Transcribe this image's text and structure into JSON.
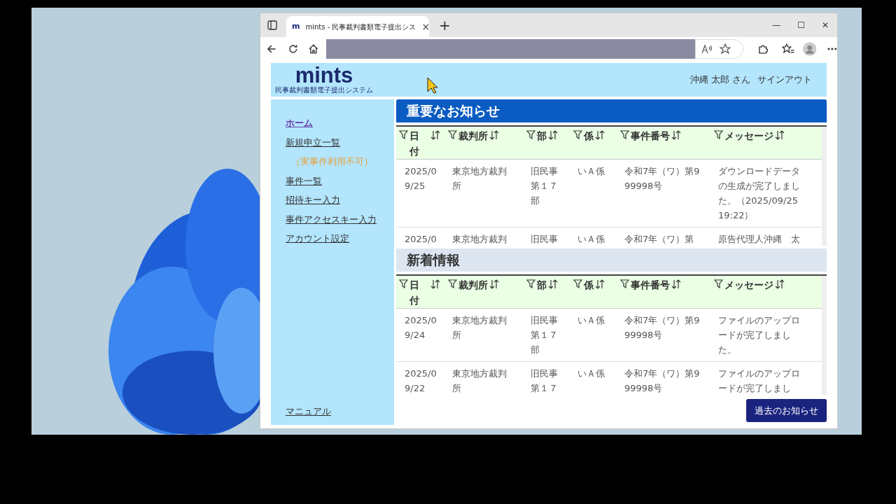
{
  "browser": {
    "favicon": "m",
    "tab_title": "mints - 民事裁判書類電子提出シス",
    "tab_close": "×",
    "new_tab": "+",
    "window_buttons": [
      "—",
      "☐",
      "✕"
    ]
  },
  "header": {
    "logo": "mints",
    "logo_subtitle": "民事裁判書類電子提出システム",
    "user": "沖縄 太郎 さん",
    "signout": "サインアウト"
  },
  "sidebar": {
    "items": [
      {
        "kind": "link",
        "label": "ホーム",
        "selected": true
      },
      {
        "kind": "link",
        "label": "新規申立一覧",
        "selected": false
      },
      {
        "kind": "note",
        "label": "（実事件利用不可）",
        "selected": false
      },
      {
        "kind": "link",
        "label": "事件一覧",
        "selected": false
      },
      {
        "kind": "link",
        "label": "招待キー入力",
        "selected": false
      },
      {
        "kind": "link",
        "label": "事件アクセスキー入力",
        "selected": false
      },
      {
        "kind": "link",
        "label": "アカウント設定",
        "selected": false
      }
    ],
    "footer_link": "マニュアル"
  },
  "sections": [
    {
      "title": "重要なお知らせ",
      "kind": "important",
      "columns": [
        "日付",
        "裁判所",
        "部",
        "係",
        "事件番号",
        "メッセージ"
      ],
      "rows": [
        [
          "2025/09/25",
          "東京地方裁判所",
          "旧民事第１７部",
          "いＡ係",
          "令和7年（ワ）第999998号",
          "ダウンロードデータの生成が完了しました。（2025/09/25 19:22）"
        ],
        [
          "2025/0",
          "東京地方裁判",
          "旧民事",
          "いＡ係",
          "令和7年（ワ）第",
          "原告代理人沖縄　太"
        ]
      ]
    },
    {
      "title": "新着情報",
      "kind": "news",
      "columns": [
        "日付",
        "裁判所",
        "部",
        "係",
        "事件番号",
        "メッセージ"
      ],
      "rows": [
        [
          "2025/09/24",
          "東京地方裁判所",
          "旧民事第１７部",
          "いＡ係",
          "令和7年（ワ）第999998号",
          "ファイルのアップロードが完了しました。"
        ],
        [
          "2025/09/22",
          "東京地方裁判所",
          "旧民事第１７",
          "いＡ係",
          "令和7年（ワ）第999998号",
          "ファイルのアップロードが完了しまし"
        ]
      ]
    }
  ],
  "past_button": "過去のお知らせ"
}
